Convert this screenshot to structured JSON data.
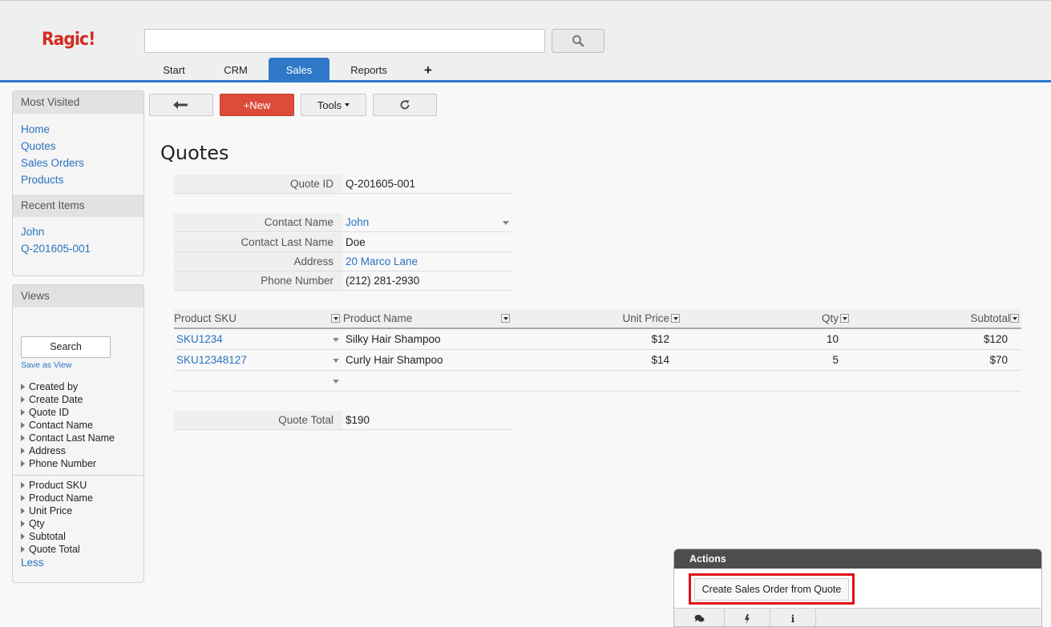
{
  "header": {
    "logo": "Ragic!",
    "search": {
      "value": "",
      "placeholder": ""
    },
    "search_icon": "search-icon",
    "tabs": [
      {
        "label": "Start",
        "active": false
      },
      {
        "label": "CRM",
        "active": false
      },
      {
        "label": "Sales",
        "active": true
      },
      {
        "label": "Reports",
        "active": false
      },
      {
        "label": "+",
        "active": false
      }
    ],
    "accent_color": "#2e78c7"
  },
  "sidebar": {
    "most_visited": {
      "title": "Most Visited",
      "links": [
        "Home",
        "Quotes",
        "Sales Orders",
        "Products"
      ]
    },
    "recent_items": {
      "title": "Recent Items",
      "links": [
        "John",
        "Q-201605-001"
      ]
    },
    "views": {
      "title": "Views",
      "search_button": "Search",
      "save_as_view": "Save as View",
      "fields_group1": [
        "Created by",
        "Create Date",
        "Quote ID",
        "Contact Name",
        "Contact Last Name",
        "Address",
        "Phone Number"
      ],
      "fields_group2": [
        "Product SKU",
        "Product Name",
        "Unit Price",
        "Qty",
        "Subtotal",
        "Quote Total"
      ],
      "less_link": "Less"
    }
  },
  "toolbar": {
    "back_icon": "back-arrow-icon",
    "new_label": "+New",
    "tools_label": "Tools",
    "refresh_icon": "refresh-icon",
    "new_color": "#dd4b39"
  },
  "form": {
    "title": "Quotes",
    "quote_id": {
      "label": "Quote ID",
      "value": "Q-201605-001"
    },
    "contact_name": {
      "label": "Contact Name",
      "value": "John"
    },
    "contact_last_name": {
      "label": "Contact Last Name",
      "value": "Doe"
    },
    "address": {
      "label": "Address",
      "value": "20 Marco Lane"
    },
    "phone_number": {
      "label": "Phone Number",
      "value": "(212) 281-2930"
    },
    "quote_total": {
      "label": "Quote Total",
      "value": "$190"
    }
  },
  "subtable": {
    "headers": {
      "sku": "Product SKU",
      "name": "Product Name",
      "unit_price": "Unit Price",
      "qty": "Qty",
      "subtotal": "Subtotal"
    },
    "rows": [
      {
        "sku": "SKU1234",
        "name": "Silky Hair Shampoo",
        "unit_price": "$12",
        "qty": "10",
        "subtotal": "$120"
      },
      {
        "sku": "SKU12348127",
        "name": "Curly Hair Shampoo",
        "unit_price": "$14",
        "qty": "5",
        "subtotal": "$70"
      }
    ]
  },
  "actions": {
    "title": "Actions",
    "create_sales_order": "Create Sales Order from Quote",
    "highlight_color": "#e0101a",
    "footer_icons": [
      "comment-icon",
      "bolt-icon",
      "info-icon"
    ]
  }
}
